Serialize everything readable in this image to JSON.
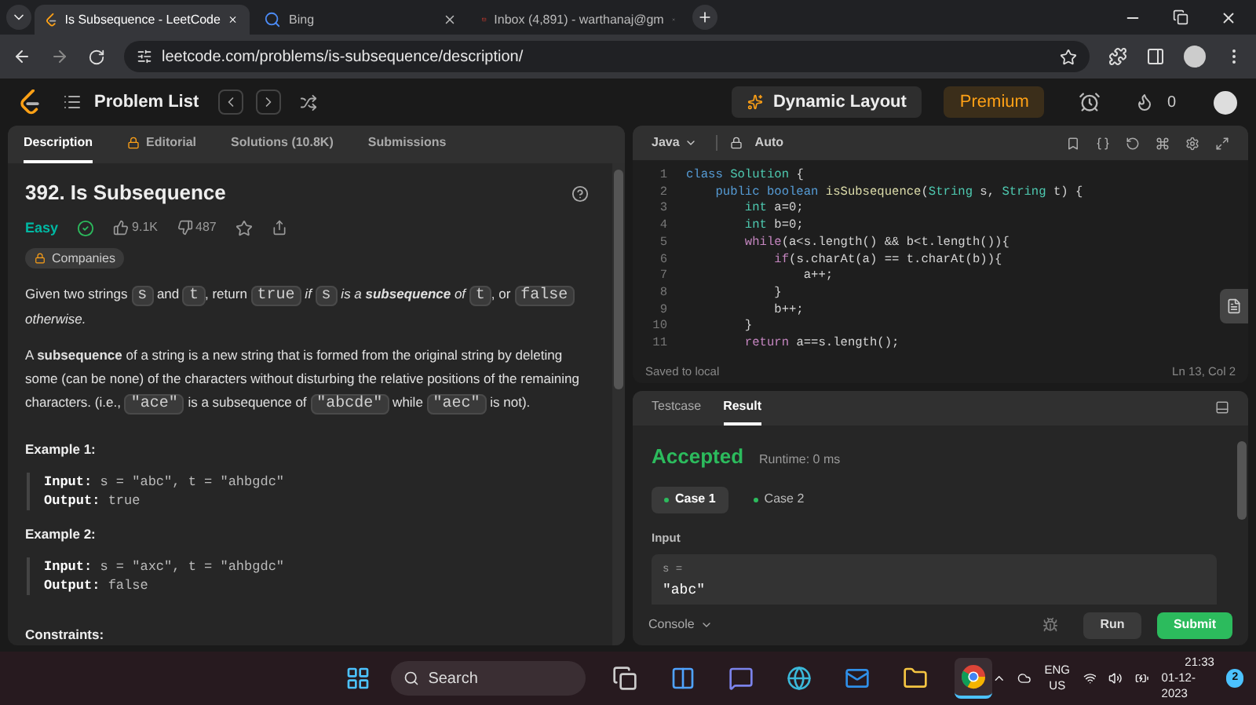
{
  "browser": {
    "tabs": [
      {
        "title": "Is Subsequence - LeetCode",
        "selected": true,
        "kind": "leetcode"
      },
      {
        "title": "Bing",
        "selected": false,
        "kind": "search"
      },
      {
        "title": "Inbox (4,891) - warthanaj@gm",
        "selected": false,
        "kind": "mail"
      }
    ],
    "url": "leetcode.com/problems/is-subsequence/description/"
  },
  "header": {
    "problem_list": "Problem List",
    "dynamic_layout": "Dynamic Layout",
    "premium": "Premium",
    "streak": "0"
  },
  "description_tabs": [
    {
      "label": "Description",
      "selected": true,
      "locked": false
    },
    {
      "label": "Editorial",
      "selected": false,
      "locked": true
    },
    {
      "label": "Solutions (10.8K)",
      "selected": false,
      "locked": false
    },
    {
      "label": "Submissions",
      "selected": false,
      "locked": false
    }
  ],
  "problem": {
    "title": "392. Is Subsequence",
    "difficulty": "Easy",
    "solved": true,
    "likes": "9.1K",
    "dislikes": "487",
    "companies": "Companies",
    "paragraphs": [
      [
        {
          "kind": "text",
          "text": "Given two strings "
        },
        {
          "kind": "code",
          "text": "s"
        },
        {
          "kind": "text",
          "text": " and "
        },
        {
          "kind": "code",
          "text": "t"
        },
        {
          "kind": "text",
          "text": ", return "
        },
        {
          "kind": "code",
          "text": "true"
        },
        {
          "kind": "italic",
          "text": " if "
        },
        {
          "kind": "code",
          "text": "s"
        },
        {
          "kind": "italic",
          "text": " is a "
        },
        {
          "kind": "bold_italic",
          "text": "subsequence"
        },
        {
          "kind": "italic",
          "text": " of "
        },
        {
          "kind": "code",
          "text": "t"
        },
        {
          "kind": "text",
          "text": ", or "
        },
        {
          "kind": "code",
          "text": "false"
        },
        {
          "kind": "italic",
          "text": " otherwise."
        }
      ],
      [
        {
          "kind": "text",
          "text": "A "
        },
        {
          "kind": "bold",
          "text": "subsequence"
        },
        {
          "kind": "text",
          "text": " of a string is a new string that is formed from the original string by deleting some (can be none) of the characters without disturbing the relative positions of the remaining characters. (i.e., "
        },
        {
          "kind": "code",
          "text": "\"ace\""
        },
        {
          "kind": "text",
          "text": " is a subsequence of "
        },
        {
          "kind": "code",
          "text": "\"abcde\""
        },
        {
          "kind": "text",
          "text": " while "
        },
        {
          "kind": "code",
          "text": "\"aec\""
        },
        {
          "kind": "text",
          "text": " is not)."
        }
      ]
    ],
    "examples": [
      {
        "title": "Example 1:",
        "lines": [
          {
            "label": "Input:",
            "value": "s = \"abc\", t = \"ahbgdc\""
          },
          {
            "label": "Output:",
            "value": "true"
          }
        ]
      },
      {
        "title": "Example 2:",
        "lines": [
          {
            "label": "Input:",
            "value": "s = \"axc\", t = \"ahbgdc\""
          },
          {
            "label": "Output:",
            "value": "false"
          }
        ]
      }
    ],
    "constraints_title": "Constraints:"
  },
  "editor": {
    "language": "Java",
    "mode": "Auto",
    "status": "Saved to local",
    "cursor": "Ln 13, Col 2",
    "lines": [
      {
        "number": "1",
        "tokens": [
          {
            "kind": "keyword",
            "text": "class "
          },
          {
            "kind": "type",
            "text": "Solution"
          },
          {
            "kind": "plain",
            "text": " {"
          }
        ]
      },
      {
        "number": "2",
        "tokens": [
          {
            "kind": "keyword",
            "text": "    public boolean "
          },
          {
            "kind": "name",
            "text": "isSubsequence"
          },
          {
            "kind": "plain",
            "text": "("
          },
          {
            "kind": "type",
            "text": "String"
          },
          {
            "kind": "plain",
            "text": " s, "
          },
          {
            "kind": "type",
            "text": "String"
          },
          {
            "kind": "plain",
            "text": " t) {"
          }
        ]
      },
      {
        "number": "3",
        "tokens": [
          {
            "kind": "type",
            "text": "        int"
          },
          {
            "kind": "plain",
            "text": " a=0;"
          }
        ]
      },
      {
        "number": "4",
        "tokens": [
          {
            "kind": "type",
            "text": "        int"
          },
          {
            "kind": "plain",
            "text": " b=0;"
          }
        ]
      },
      {
        "number": "5",
        "tokens": [
          {
            "kind": "control",
            "text": "        while"
          },
          {
            "kind": "plain",
            "text": "(a<s.length() && b<t.length()){"
          }
        ]
      },
      {
        "number": "6",
        "tokens": [
          {
            "kind": "control",
            "text": "            if"
          },
          {
            "kind": "plain",
            "text": "(s.charAt(a) == t.charAt(b)){"
          }
        ]
      },
      {
        "number": "7",
        "tokens": [
          {
            "kind": "plain",
            "text": "                a++;"
          }
        ]
      },
      {
        "number": "8",
        "tokens": [
          {
            "kind": "plain",
            "text": "            }"
          }
        ]
      },
      {
        "number": "9",
        "tokens": [
          {
            "kind": "plain",
            "text": "            b++;"
          }
        ]
      },
      {
        "number": "10",
        "tokens": [
          {
            "kind": "plain",
            "text": "        }"
          }
        ]
      },
      {
        "number": "11",
        "tokens": [
          {
            "kind": "control",
            "text": "        return"
          },
          {
            "kind": "plain",
            "text": " a==s.length();"
          }
        ]
      }
    ]
  },
  "result": {
    "tabs": [
      {
        "label": "Testcase",
        "selected": false
      },
      {
        "label": "Result",
        "selected": true
      }
    ],
    "verdict": "Accepted",
    "runtime": "Runtime: 0 ms",
    "cases": [
      {
        "label": "Case 1",
        "selected": true,
        "passed": true
      },
      {
        "label": "Case 2",
        "selected": false,
        "passed": true
      }
    ],
    "input_label": "Input",
    "input_name": "s =",
    "input_value": "\"abc\"",
    "console": "Console",
    "run": "Run",
    "submit": "Submit"
  },
  "taskbar": {
    "search": "Search",
    "apps": [
      {
        "kind": "task-view",
        "selected": false
      },
      {
        "kind": "widgets",
        "selected": false
      },
      {
        "kind": "chat",
        "selected": false
      },
      {
        "kind": "edge",
        "selected": false
      },
      {
        "kind": "mail",
        "selected": false
      },
      {
        "kind": "folder",
        "selected": false
      },
      {
        "kind": "chrome",
        "selected": true
      }
    ],
    "language": "ENG",
    "region": "US",
    "time": "21:33",
    "date": "01-12-2023",
    "notifications": "2"
  }
}
